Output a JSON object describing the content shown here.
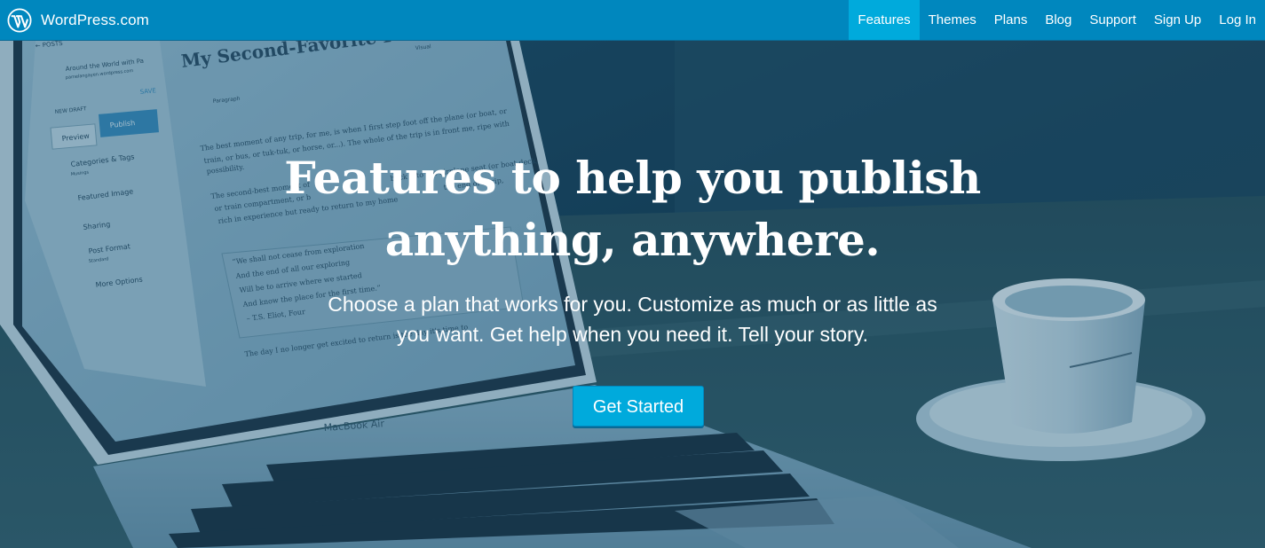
{
  "brand": {
    "name": "WordPress.com"
  },
  "nav": {
    "items": [
      {
        "label": "Features",
        "active": true
      },
      {
        "label": "Themes",
        "active": false
      },
      {
        "label": "Plans",
        "active": false
      },
      {
        "label": "Blog",
        "active": false
      },
      {
        "label": "Support",
        "active": false
      },
      {
        "label": "Sign Up",
        "active": false
      },
      {
        "label": "Log In",
        "active": false
      }
    ]
  },
  "hero": {
    "title_line1": "Features to help you publish",
    "title_line2": "anything, anywhere.",
    "subtitle_line1": "Choose a plan that works for you. Customize as much or as little as",
    "subtitle_line2": "you want. Get help when you need it. Tell your story.",
    "cta_label": "Get Started"
  },
  "background_photo": {
    "laptop_label": "MacBook Air",
    "editor": {
      "post_title": "My Second-Favorite P",
      "breadcrumb": "← POSTS",
      "site_name": "Around the World with Pa",
      "site_url": "pamelangayen.wordpress.com",
      "save_label": "SAVE",
      "draft_label": "NEW DRAFT",
      "preview_label": "Preview",
      "publish_label": "Publish",
      "visual_tab": "Visual",
      "format_select": "Paragraph",
      "sidebar_sections": [
        "Categories & Tags",
        "Featured Image",
        "Sharing",
        "Post Format",
        "More Options"
      ],
      "categories_sub": "Musings",
      "post_format_sub": "Standard",
      "body_lines": [
        "The best moment of any trip, for me, is when I first step foot off the plane (or boat, or",
        "train, or bus, or tuk-tuk, or horse, or...). The whole of the trip is in front me, ripe with",
        "possibility.",
        "The second-best moment of",
        "or train compartment, or b",
        "rich in experience but ready to return to my home"
      ],
      "body_lines_right": [
        "back into the airplane seat (or boat deck,",
        "the end of a trip,"
      ],
      "quote_lines": [
        "“We shall not cease from exploration",
        "And the end of all our exploring",
        "Will be to arrive where we started",
        "And know the place for the first time.”",
        "– T.S. Eliot, Four"
      ],
      "closing_line": "The day I no longer get excited to return is the day it's time to"
    },
    "colors": {
      "bar": "#0087be",
      "accent": "#00aadc",
      "hero_tint": "#16384e"
    }
  },
  "icons": {
    "logo": "wordpress-logo-icon"
  }
}
